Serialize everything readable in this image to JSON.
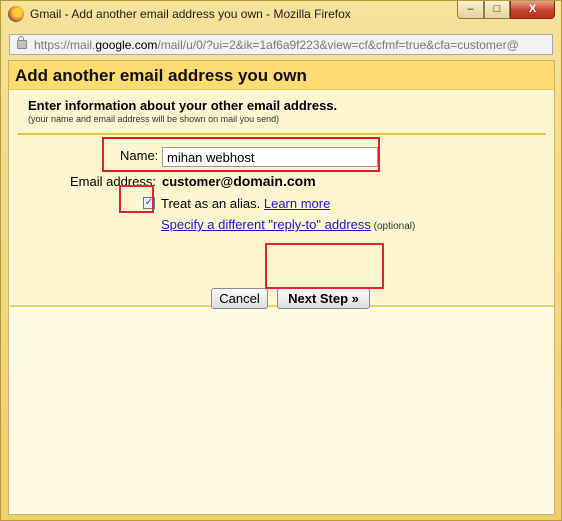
{
  "window": {
    "title": "Gmail - Add another email address you own - Mozilla Firefox",
    "min_symbol": "–",
    "max_symbol": "□",
    "close_symbol": "X"
  },
  "addressbar": {
    "url_prefix": "https://mail.",
    "url_host": "google.com",
    "url_rest": "/mail/u/0/?ui=2&ik=1af6a9f223&view=cf&cfmf=true&cfa=customer@"
  },
  "dialog": {
    "title": "Add another email address you own",
    "intro": "Enter information about your other email address.",
    "note": "(your name and email address will be shown on mail you send)",
    "name_label": "Name:",
    "name_value": "mihan webhost",
    "email_label": "Email address:",
    "email_user": "customer@",
    "email_domain": "domain.com",
    "alias_checked": "✓",
    "alias_text": "Treat as an alias. ",
    "learn_more": "Learn more",
    "reply_to_link": "Specify a different \"reply-to\" address",
    "optional": " (optional)",
    "cancel_label": "Cancel",
    "next_label": "Next Step »"
  },
  "icons": {
    "app": "firefox-icon",
    "lock": "lock-icon",
    "checkbox": "checkmark-icon"
  },
  "colors": {
    "dialog_title_bg": "#fddb70",
    "highlight": "#e2222e",
    "link": "#1a1acc"
  }
}
